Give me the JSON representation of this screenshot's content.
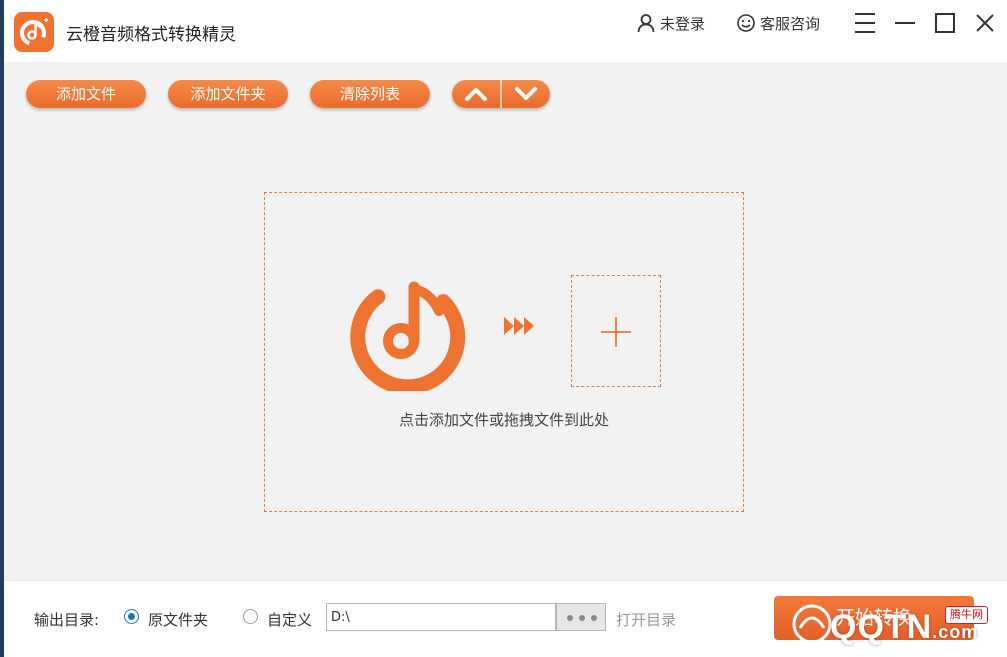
{
  "app": {
    "title": "云橙音频格式转换精灵"
  },
  "header": {
    "login_label": "未登录",
    "support_label": "客服咨询"
  },
  "toolbar": {
    "add_file_label": "添加文件",
    "add_folder_label": "添加文件夹",
    "clear_list_label": "清除列表"
  },
  "dropzone": {
    "hint": "点击添加文件或拖拽文件到此处"
  },
  "output": {
    "label": "输出目录:",
    "options": [
      "原文件夹",
      "自定义"
    ],
    "selected": "原文件夹",
    "path_value": "D:\\",
    "open_dir_label": "打开目录"
  },
  "actions": {
    "start_label": "开始转换"
  },
  "watermark": {
    "text": "QQTN",
    "suffix": ".com",
    "badge": "腾牛网"
  },
  "colors": {
    "accent": "#ee7330",
    "radio_selected": "#1a73c9",
    "taskbar": "#1d3d62"
  },
  "icons": {
    "logo": "orange-music-note-logo",
    "login": "user-icon",
    "support": "smiley-icon",
    "menu": "hamburger-icon",
    "minimize": "minimize-icon",
    "maximize": "maximize-icon",
    "close": "close-icon",
    "move_up": "chevron-up-icon",
    "move_down": "chevron-down-icon",
    "arrows": "fast-forward-icon",
    "add": "plus-icon",
    "browse": "ellipsis-icon"
  }
}
